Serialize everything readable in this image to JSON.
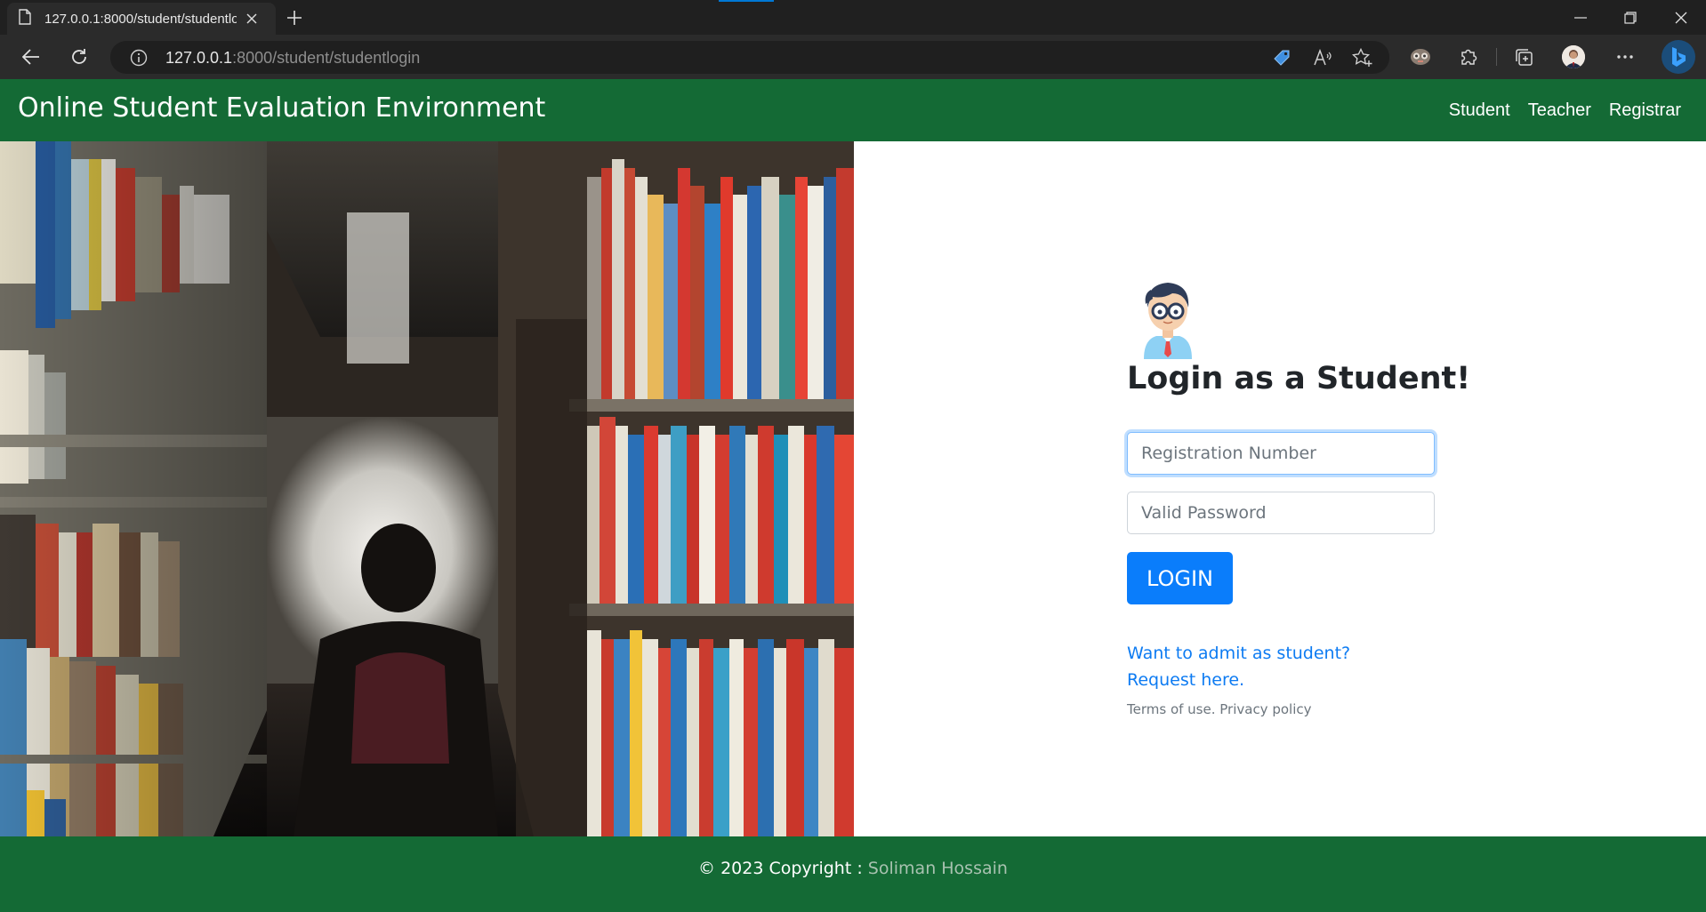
{
  "browser": {
    "tab_title": "127.0.0.1:8000/student/studentlogin",
    "url_host": "127.0.0.1",
    "url_rest": ":8000/student/studentlogin",
    "icons": [
      "page-icon",
      "close-icon",
      "plus-icon",
      "minimize-icon",
      "restore-icon",
      "close-window-icon",
      "back-icon",
      "refresh-icon",
      "info-icon",
      "tag-icon",
      "read-aloud-icon",
      "favorite-icon",
      "extension-icon",
      "puzzle-icon",
      "collections-icon",
      "profile-icon",
      "more-icon",
      "bing-icon"
    ]
  },
  "navbar": {
    "brand": "Online Student Evaluation Environment",
    "links": [
      "Student",
      "Teacher",
      "Registrar"
    ]
  },
  "login": {
    "title": "Login as a Student!",
    "registration_placeholder": "Registration Number",
    "password_placeholder": "Valid Password",
    "button": "LOGIN",
    "admit_line1": "Want to admit as student?",
    "admit_line2": "Request here.",
    "terms": "Terms of use. Privacy policy"
  },
  "footer": {
    "copyright": "© 2023 Copyright :",
    "author": "Soliman Hossain"
  },
  "colors": {
    "brand_green": "#146a35",
    "primary_blue": "#0a7dfb",
    "link_blue": "#0d7bf2"
  }
}
